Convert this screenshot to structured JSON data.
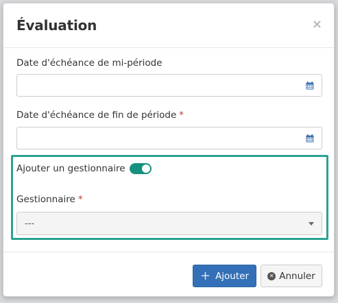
{
  "modal": {
    "title": "Évaluation",
    "close_symbol": "×"
  },
  "fields": {
    "mid_period": {
      "label": "Date d'échéance de mi-période",
      "value": "",
      "icon": "calendar-icon"
    },
    "end_period": {
      "label": "Date d'échéance de fin de période",
      "required_mark": "*",
      "value": "",
      "icon": "calendar-icon"
    },
    "add_manager": {
      "label": "Ajouter un gestionnaire",
      "toggle_on": true
    },
    "manager": {
      "label": "Gestionnaire",
      "required_mark": "*",
      "selected": "---"
    }
  },
  "footer": {
    "add_label": "Ajouter",
    "add_icon": "plus-icon",
    "cancel_label": "Annuler",
    "cancel_icon": "x-circle-icon"
  },
  "colors": {
    "primary": "#3370b7",
    "toggle_on": "#16917d",
    "highlight": "#2aa392",
    "required": "#c0392b"
  }
}
